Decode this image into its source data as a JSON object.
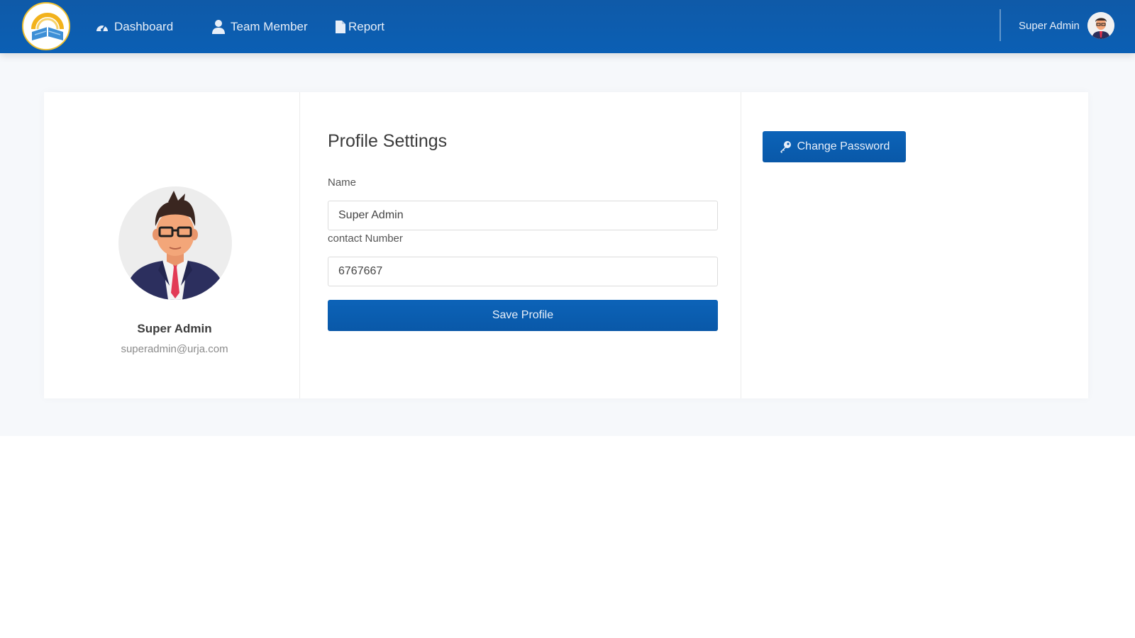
{
  "navbar": {
    "items": [
      {
        "label": "Dashboard",
        "icon": "dashboard-icon"
      },
      {
        "label": "Team Member",
        "icon": "user-icon"
      },
      {
        "label": "Report",
        "icon": "file-icon"
      }
    ],
    "user_name": "Super Admin"
  },
  "profile": {
    "name": "Super Admin",
    "email": "superadmin@urja.com"
  },
  "form": {
    "title": "Profile Settings",
    "name_label": "Name",
    "name_value": "Super Admin",
    "contact_label": "contact Number",
    "contact_value": "6767667",
    "save_label": "Save Profile"
  },
  "actions": {
    "change_password_label": "Change Password"
  },
  "colors": {
    "primary": "#0b5fb4",
    "logo_ring": "#f2c230",
    "page_background": "#f6f8fb"
  }
}
